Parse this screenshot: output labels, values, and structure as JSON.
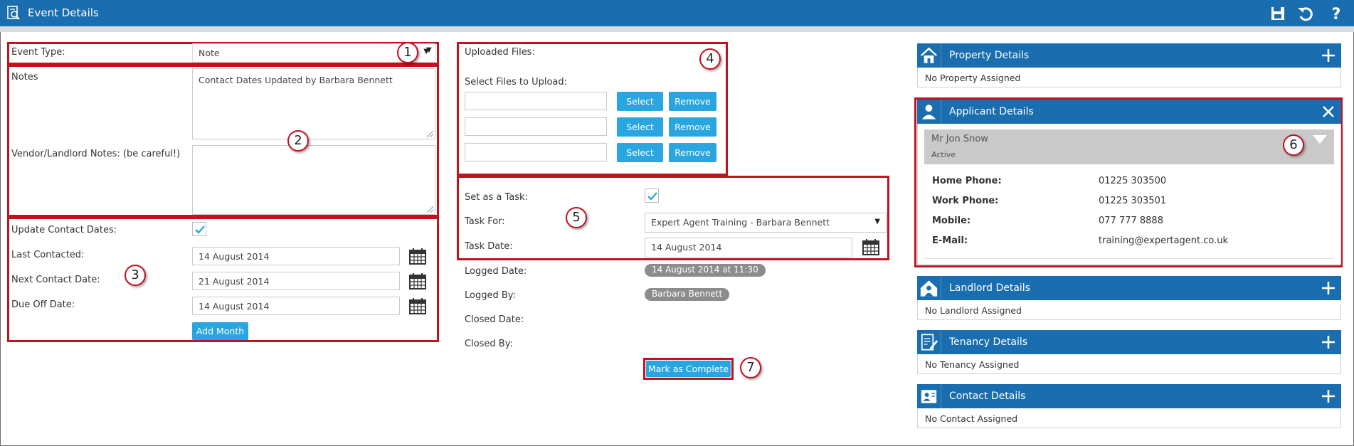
{
  "window": {
    "title": "Event Details",
    "icons": [
      "event-search-icon",
      "save-icon",
      "undo-icon",
      "help-icon"
    ]
  },
  "event": {
    "event_type_label": "Event Type:",
    "event_type_value": "Note",
    "notes_label": "Notes",
    "notes_value": "Contact Dates Updated by Barbara Bennett",
    "vendor_notes_label": "Vendor/Landlord Notes: (be careful!)",
    "vendor_notes_value": "",
    "update_contact_label": "Update Contact Dates:",
    "update_contact_checked": true,
    "last_contacted_label": "Last Contacted:",
    "last_contacted_value": "14 August 2014",
    "next_contact_label": "Next Contact Date:",
    "next_contact_value": "21 August 2014",
    "due_off_label": "Due Off Date:",
    "due_off_value": "14 August 2014",
    "add_month_label": "Add Month"
  },
  "files": {
    "uploaded_label": "Uploaded Files:",
    "select_label": "Select Files to Upload:",
    "rows": [
      {
        "value": "",
        "select": "Select",
        "remove": "Remove"
      },
      {
        "value": "",
        "select": "Select",
        "remove": "Remove"
      },
      {
        "value": "",
        "select": "Select",
        "remove": "Remove"
      }
    ]
  },
  "task": {
    "set_task_label": "Set as a Task:",
    "set_task_checked": true,
    "task_for_label": "Task For:",
    "task_for_value": "Expert Agent Training - Barbara Bennett",
    "task_date_label": "Task Date:",
    "task_date_value": "14 August 2014",
    "logged_date_label": "Logged Date:",
    "logged_date_value": "14 August 2014 at 11:30",
    "logged_by_label": "Logged By:",
    "logged_by_value": "Barbara Bennett",
    "closed_date_label": "Closed Date:",
    "closed_by_label": "Closed By:",
    "complete_label": "Mark as Complete"
  },
  "panels": {
    "property": {
      "title": "Property Details",
      "body": "No Property Assigned"
    },
    "applicant": {
      "title": "Applicant Details",
      "name": "Mr Jon Snow",
      "status": "Active",
      "home_phone_label": "Home Phone:",
      "home_phone": "01225 303500",
      "work_phone_label": "Work Phone:",
      "work_phone": "01225 303501",
      "mobile_label": "Mobile:",
      "mobile": "077 777 8888",
      "email_label": "E-Mail:",
      "email": "training@expertagent.co.uk"
    },
    "landlord": {
      "title": "Landlord Details",
      "body": "No Landlord Assigned"
    },
    "tenancy": {
      "title": "Tenancy Details",
      "body": "No Tenancy Assigned"
    },
    "contact": {
      "title": "Contact Details",
      "body": "No Contact Assigned"
    }
  },
  "callouts": [
    "1",
    "2",
    "3",
    "4",
    "5",
    "6",
    "7"
  ],
  "colors": {
    "header_blue": "#1a6eaf",
    "button_blue": "#29a6df",
    "annotation_red": "#c1121f",
    "pill_grey": "#8c8c8c"
  }
}
